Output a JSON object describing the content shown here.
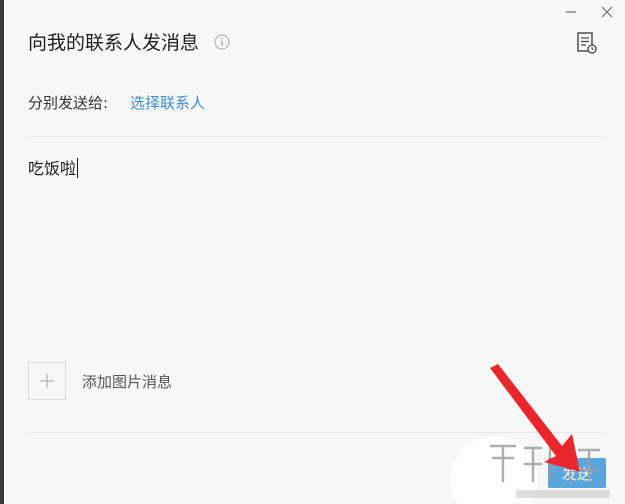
{
  "dialog": {
    "title": "向我的联系人发消息",
    "recipient_label": "分别发送给:",
    "recipient_link": "选择联系人",
    "message_text": "吃饭啦",
    "add_image_label": "添加图片消息",
    "send_label": "发送"
  },
  "icons": {
    "minimize": "minimize-icon",
    "close": "close-icon",
    "info": "info-icon",
    "document": "document-icon",
    "plus": "plus-icon"
  },
  "colors": {
    "link": "#3e8ed0",
    "send_button": "#5aa5de",
    "annotation_arrow": "#e8262b"
  }
}
